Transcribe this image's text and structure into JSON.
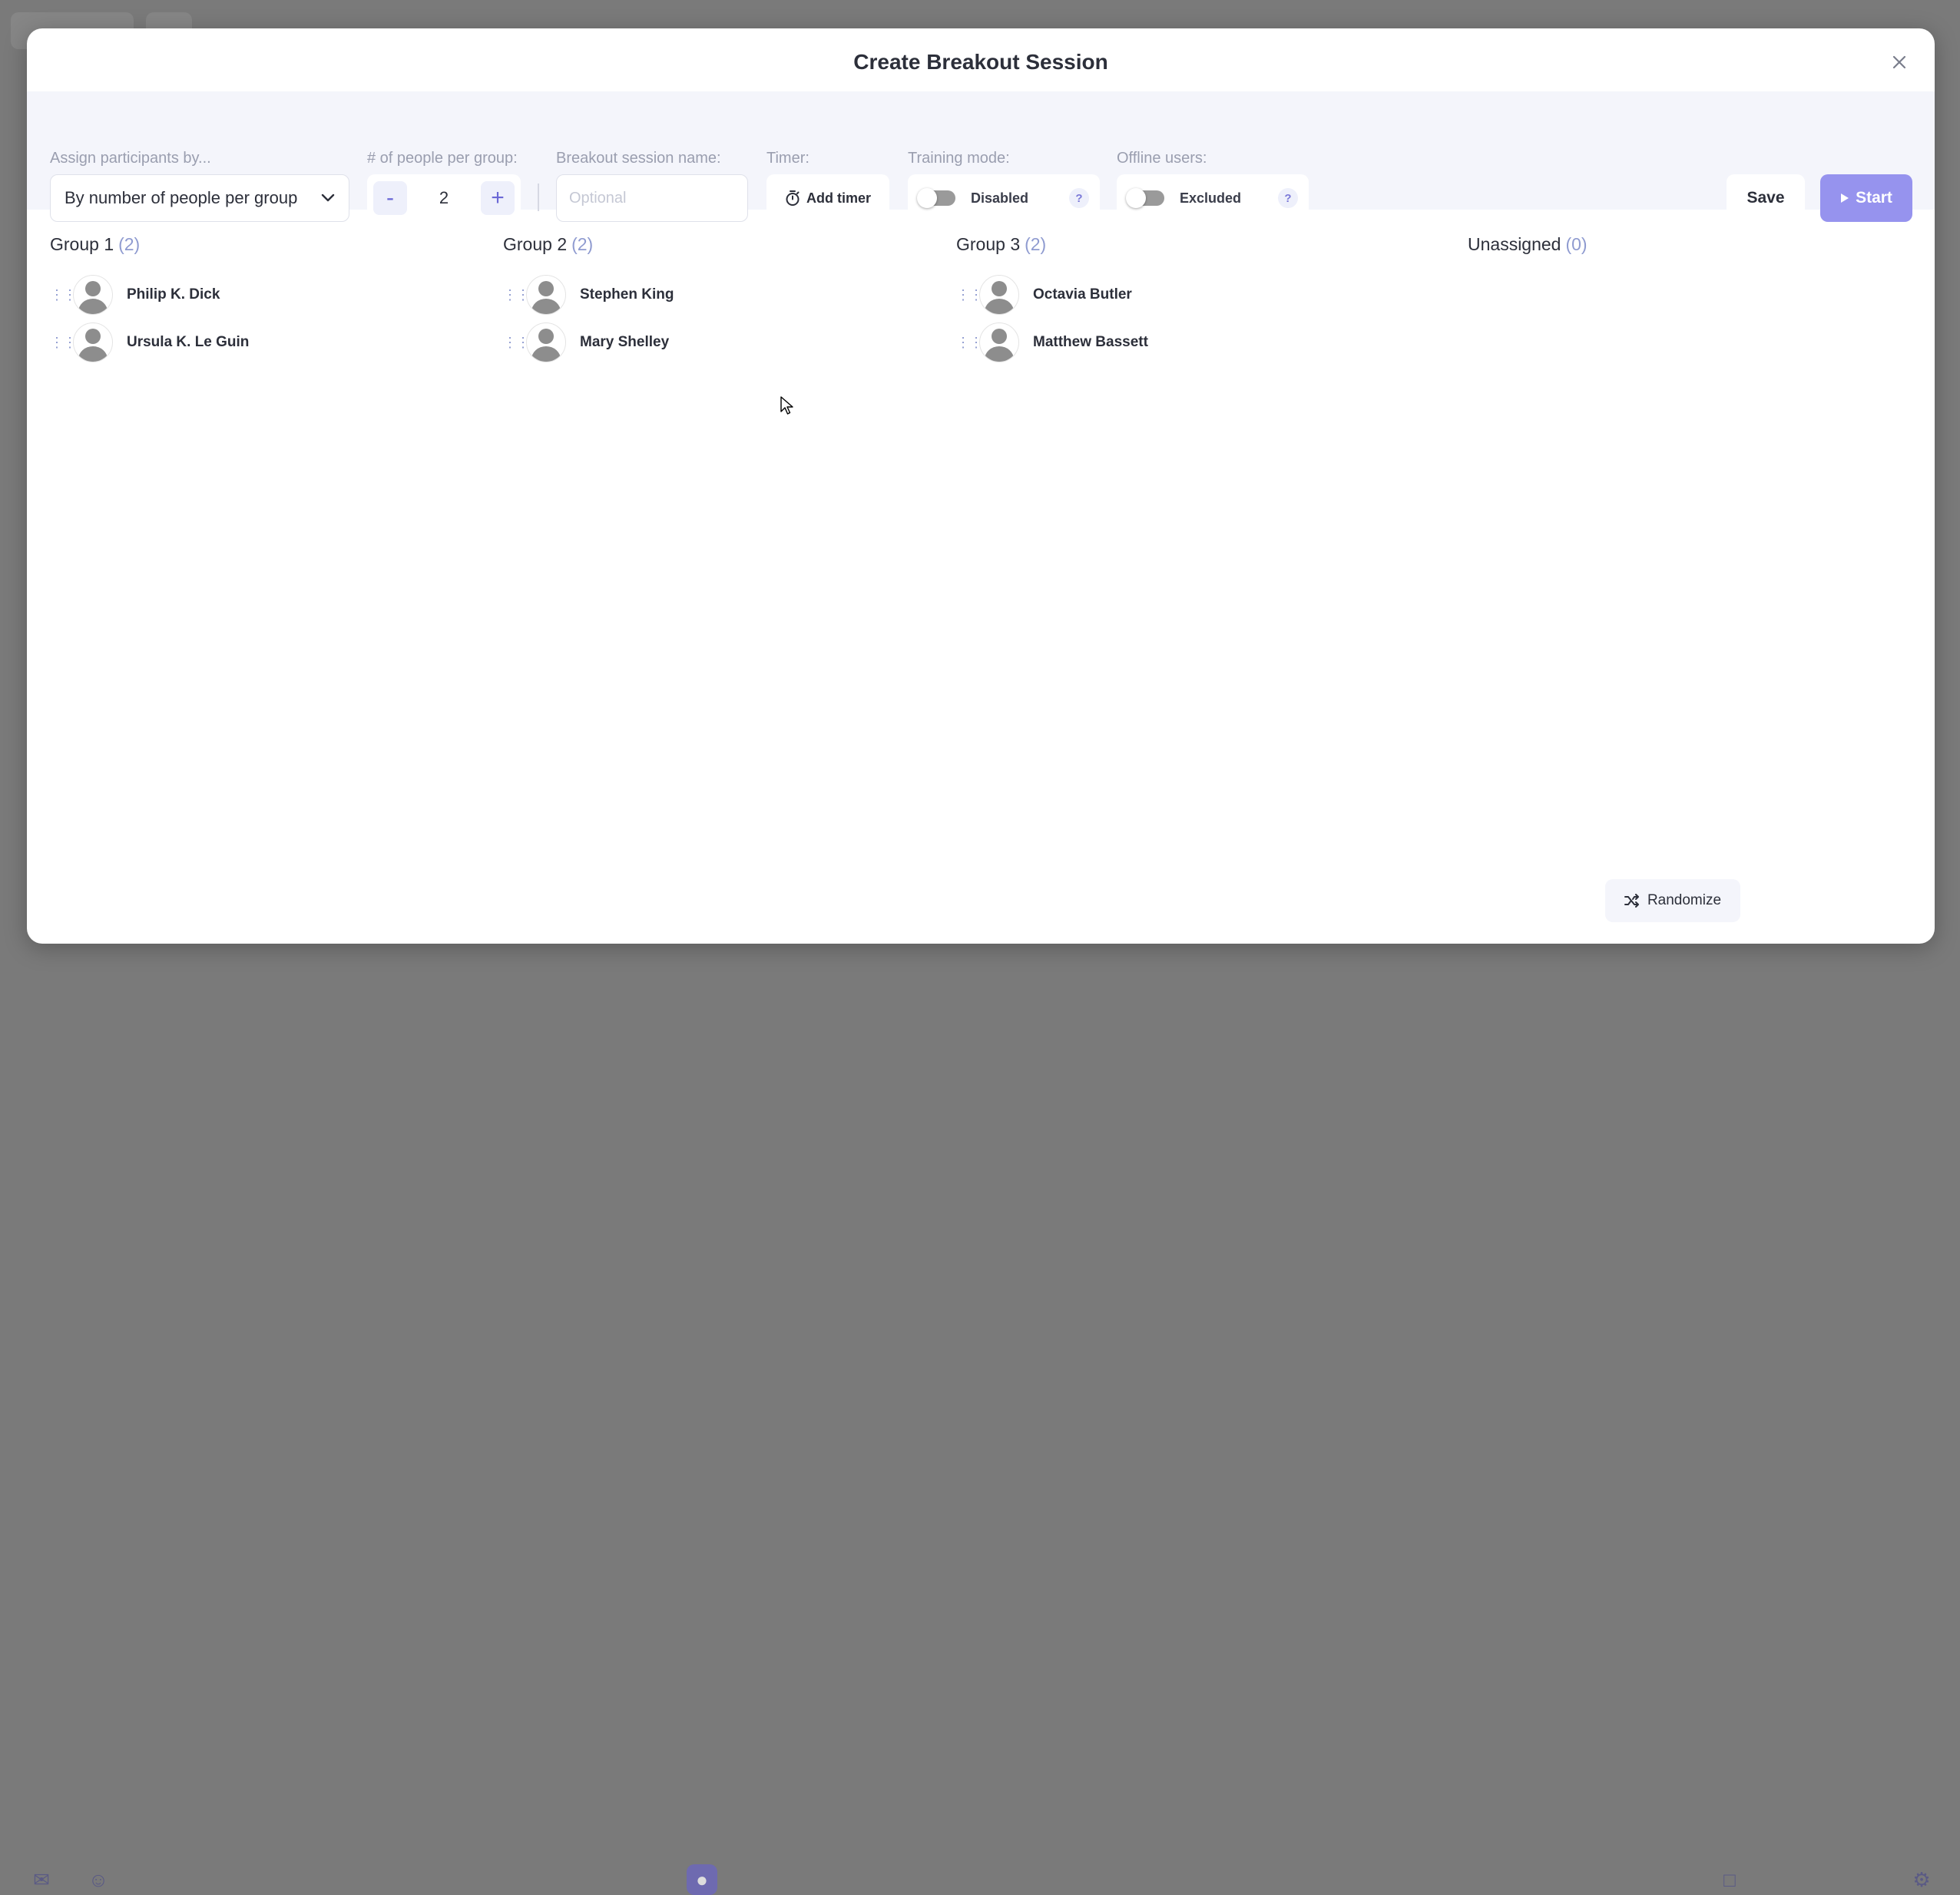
{
  "modal": {
    "title": "Create Breakout Session",
    "close_icon": "close-icon"
  },
  "toolbar": {
    "assign_label": "Assign participants by...",
    "assign_value": "By number of people per group",
    "people_label": "# of people per group:",
    "people_minus": "-",
    "people_value": "2",
    "people_plus": "+",
    "name_label": "Breakout session name:",
    "name_placeholder": "Optional",
    "name_value": "",
    "timer_label": "Timer:",
    "timer_button": "Add timer",
    "training_label": "Training mode:",
    "training_state": "Disabled",
    "training_on": false,
    "offline_label": "Offline users:",
    "offline_state": "Excluded",
    "offline_on": false,
    "help": "?",
    "save_label": "Save",
    "start_label": "Start"
  },
  "groups": [
    {
      "title": "Group 1",
      "count": "(2)",
      "members": [
        "Philip K. Dick",
        "Ursula K. Le Guin"
      ]
    },
    {
      "title": "Group 2",
      "count": "(2)",
      "members": [
        "Stephen King",
        "Mary Shelley"
      ]
    },
    {
      "title": "Group 3",
      "count": "(2)",
      "members": [
        "Octavia Butler",
        "Matthew Bassett"
      ]
    },
    {
      "title": "Unassigned",
      "count": "(0)",
      "members": []
    }
  ],
  "randomize_label": "Randomize",
  "colors": {
    "accent": "#6b68d6",
    "start_button": "#9693ee",
    "toolbar_bg": "#f4f5fb",
    "count_text": "#8f9bd0"
  }
}
